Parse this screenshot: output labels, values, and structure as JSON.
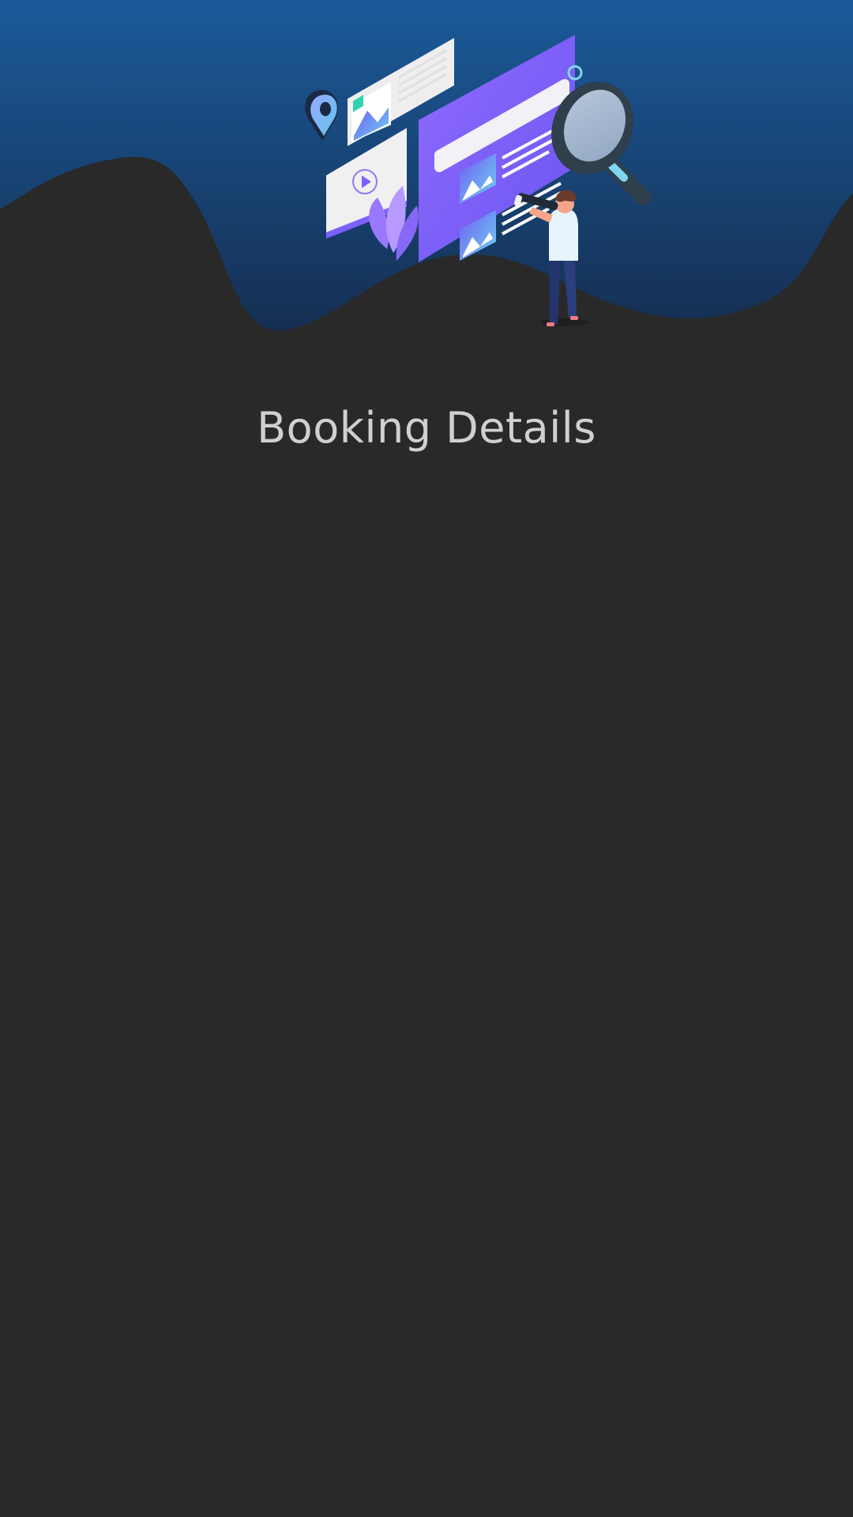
{
  "header": {
    "title": "Booking Details",
    "illustration": "person-with-telescope-searching-listings-illustration"
  },
  "colors": {
    "background": "#292929",
    "header_gradient_top": "#1b5a9a",
    "header_gradient_bottom": "#152f52",
    "title_text": "#d0d0d0",
    "accent_purple": "#7b61ff",
    "accent_cyan": "#7fd6f0"
  }
}
